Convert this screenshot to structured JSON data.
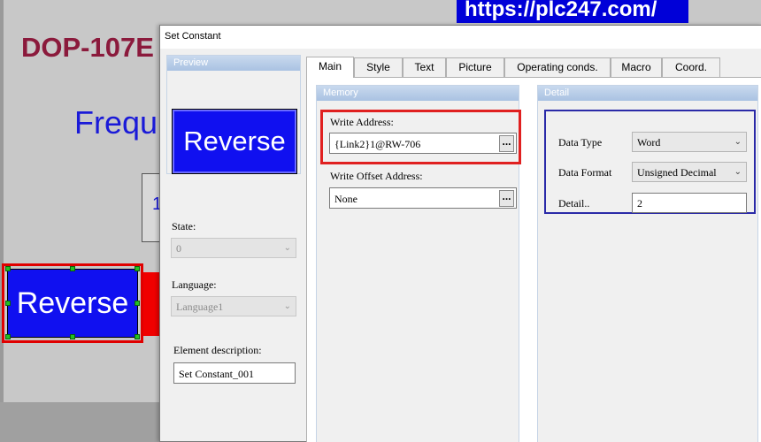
{
  "watermark": "https://plc247.com/",
  "background": {
    "title": "DOP-107E",
    "freq_label": "Frequ",
    "box_digit": "1",
    "button_label": "Reverse"
  },
  "dialog": {
    "title": "Set Constant",
    "preview": {
      "header": "Preview",
      "button_label": "Reverse"
    },
    "state": {
      "label": "State:",
      "value": "0"
    },
    "language": {
      "label": "Language:",
      "value": "Language1"
    },
    "element_description": {
      "label": "Element description:",
      "value": "Set Constant_001"
    },
    "tabs": [
      "Main",
      "Style",
      "Text",
      "Picture",
      "Operating conds.",
      "Macro",
      "Coord."
    ],
    "active_tab": "Main",
    "memory": {
      "header": "Memory",
      "write_address_label": "Write Address:",
      "write_address_value": "{Link2}1@RW-706",
      "write_offset_label": "Write Offset Address:",
      "write_offset_value": "None",
      "browse_label": "..."
    },
    "detail": {
      "header": "Detail",
      "data_type_label": "Data Type",
      "data_type_value": "Word",
      "data_format_label": "Data Format",
      "data_format_value": "Unsigned Decimal",
      "detail_label": "Detail..",
      "detail_value": "2"
    }
  },
  "colors": {
    "button_blue": "#1010f0",
    "highlight_red": "#e02020",
    "highlight_blue": "#2a2aa8",
    "watermark_bg": "#0000d8"
  }
}
